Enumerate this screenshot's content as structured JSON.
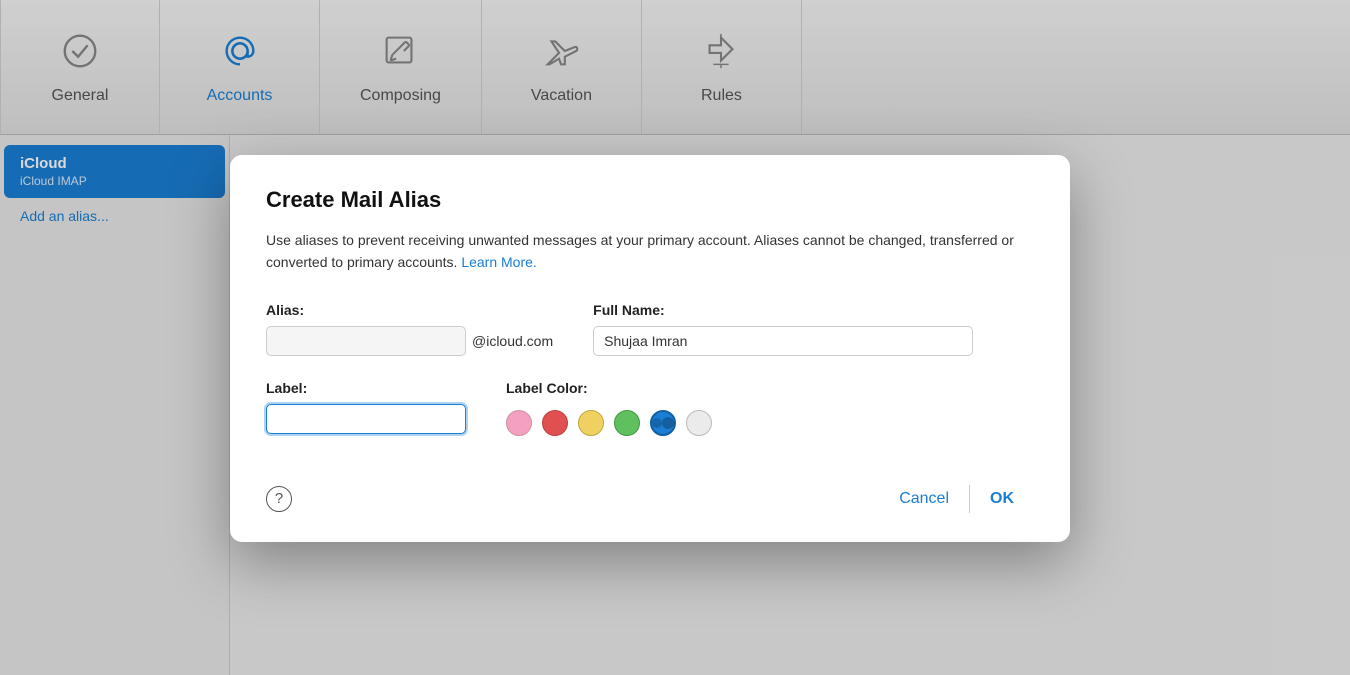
{
  "toolbar": {
    "items": [
      {
        "id": "general",
        "label": "General",
        "icon": "checkmark",
        "active": false
      },
      {
        "id": "accounts",
        "label": "Accounts",
        "icon": "at",
        "active": true
      },
      {
        "id": "composing",
        "label": "Composing",
        "icon": "compose",
        "active": false
      },
      {
        "id": "vacation",
        "label": "Vacation",
        "icon": "airplane",
        "active": false
      },
      {
        "id": "rules",
        "label": "Rules",
        "icon": "rules",
        "active": false
      }
    ]
  },
  "sidebar": {
    "accounts": [
      {
        "name": "iCloud",
        "type": "iCloud IMAP",
        "selected": true
      }
    ],
    "add_alias_label": "Add an alias..."
  },
  "dialog": {
    "title": "Create Mail Alias",
    "description": "Use aliases to prevent receiving unwanted messages at your primary account. Aliases cannot be changed, transferred or converted to primary accounts.",
    "learn_more": "Learn More.",
    "alias_label": "Alias:",
    "alias_placeholder": "",
    "alias_domain": "@icloud.com",
    "fullname_label": "Full Name:",
    "fullname_value": "Shujaa Imran",
    "label_label": "Label:",
    "label_value": "",
    "label_color_label": "Label Color:",
    "colors": [
      {
        "id": "pink",
        "hex": "#f4a0c0",
        "selected": false
      },
      {
        "id": "red",
        "hex": "#e05050",
        "selected": false
      },
      {
        "id": "yellow",
        "hex": "#f0d060",
        "selected": false
      },
      {
        "id": "green",
        "hex": "#60c060",
        "selected": false
      },
      {
        "id": "blue",
        "hex": "#1a7fd4",
        "selected": true
      },
      {
        "id": "white",
        "hex": "#e8e8e8",
        "selected": false
      }
    ],
    "cancel_label": "Cancel",
    "ok_label": "OK"
  }
}
